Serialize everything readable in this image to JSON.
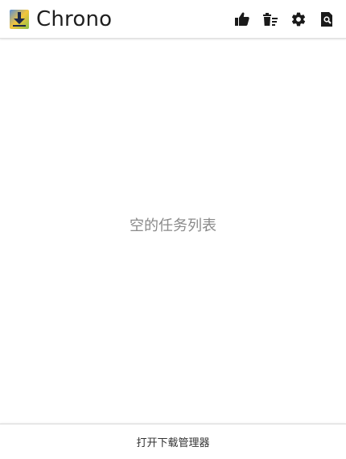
{
  "header": {
    "app_title": "Chrono",
    "logo_icon": "download-arrow-logo",
    "toolbar": [
      {
        "name": "thumbs-up-icon"
      },
      {
        "name": "clear-list-icon"
      },
      {
        "name": "settings-gear-icon"
      },
      {
        "name": "search-document-icon"
      }
    ]
  },
  "main": {
    "empty_message": "空的任务列表"
  },
  "footer": {
    "open_manager_label": "打开下载管理器"
  },
  "colors": {
    "text_primary": "#1f1f1f",
    "text_muted": "#8a8a8a",
    "icon": "#1a1a1a",
    "logo_blue": "#3b6fb6",
    "logo_yellow": "#f3c53b",
    "logo_green": "#8bc34a"
  }
}
